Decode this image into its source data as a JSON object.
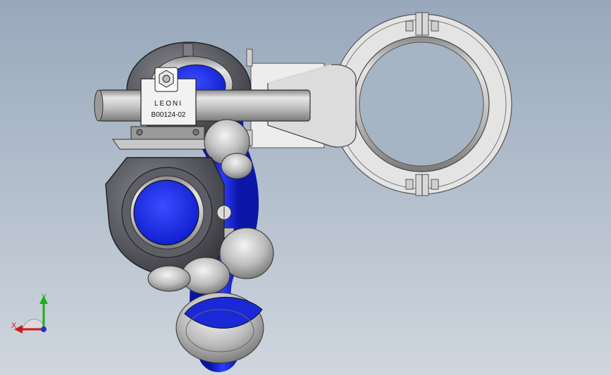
{
  "viewport": {
    "background_top": "#98a8bb",
    "background_bottom": "#cfd6de"
  },
  "model": {
    "hose_color": "#1f2fe0",
    "metal_color": "#cfcfcf",
    "housing_color": "#58585e",
    "clamp_label": {
      "brand": "LEONI",
      "part_number": "B00124-02"
    }
  },
  "triad": {
    "x_label": "X",
    "y_label": "Y",
    "x_color": "#d01818",
    "y_color": "#18b018",
    "z_color": "#2030d0"
  }
}
